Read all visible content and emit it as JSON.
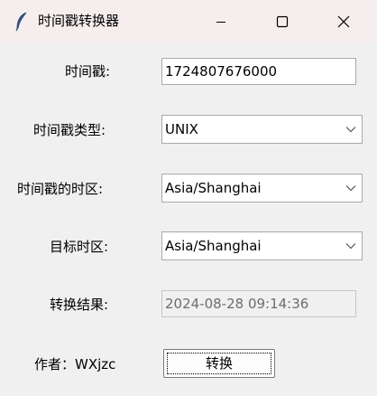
{
  "window": {
    "title": "时间戳转换器",
    "icon": "feather-icon",
    "controls": [
      "minimize-icon",
      "maximize-icon",
      "close-icon"
    ]
  },
  "form": {
    "timestamp": {
      "label": "时间戳:",
      "value": "1724807676000"
    },
    "timestamp_type": {
      "label": "时间戳类型:",
      "value": "UNIX"
    },
    "timestamp_timezone": {
      "label": "时间戳的时区:",
      "value": "Asia/Shanghai"
    },
    "target_timezone": {
      "label": "目标时区:",
      "value": "Asia/Shanghai"
    },
    "result": {
      "label": "转换结果:",
      "value": "2024-08-28 09:14:36"
    }
  },
  "footer": {
    "author": "作者：WXjzc",
    "convert_label": "转换"
  },
  "colors": {
    "titlebar": "#f6eeee",
    "window_bg": "#f0f0f0",
    "field_border": "#a9a9a9",
    "readonly_text": "#6d6d6d"
  }
}
